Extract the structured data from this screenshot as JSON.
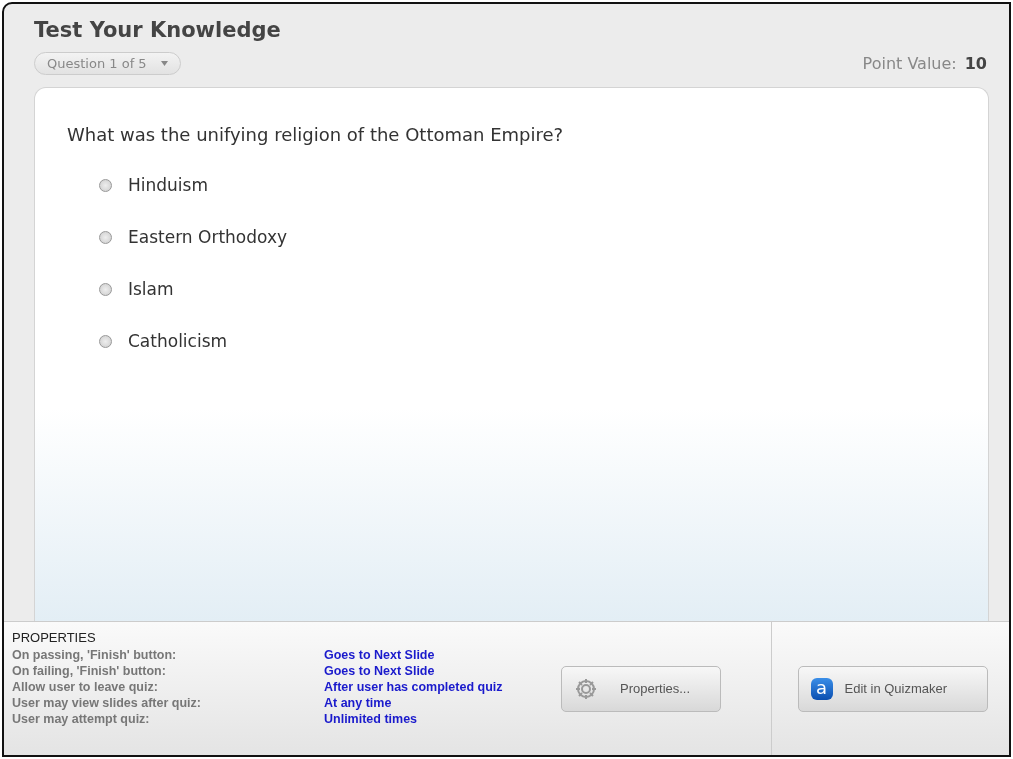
{
  "title": "Test Your Knowledge",
  "question_selector": {
    "value": "Question 1 of 5"
  },
  "point_value": {
    "label": "Point Value:",
    "value": "10"
  },
  "question": "What was the unifying religion of the Ottoman Empire?",
  "options": [
    {
      "label": "Hinduism",
      "selected": false
    },
    {
      "label": "Eastern Orthodoxy",
      "selected": false
    },
    {
      "label": "Islam",
      "selected": false
    },
    {
      "label": "Catholicism",
      "selected": false
    }
  ],
  "properties": {
    "heading": "PROPERTIES",
    "rows": [
      {
        "label": "On passing, 'Finish' button:",
        "value": "Goes to Next Slide"
      },
      {
        "label": "On failing, 'Finish' button:",
        "value": "Goes to Next Slide"
      },
      {
        "label": "Allow user to leave quiz:",
        "value": "After user has completed quiz"
      },
      {
        "label": "User may view slides after quiz:",
        "value": "At any time"
      },
      {
        "label": "User may attempt quiz:",
        "value": "Unlimited times"
      }
    ]
  },
  "buttons": [
    {
      "kind": "properties",
      "label": "Properties..."
    },
    {
      "kind": "edit",
      "label": "Edit in Quizmaker",
      "icon_letter": "a"
    }
  ]
}
